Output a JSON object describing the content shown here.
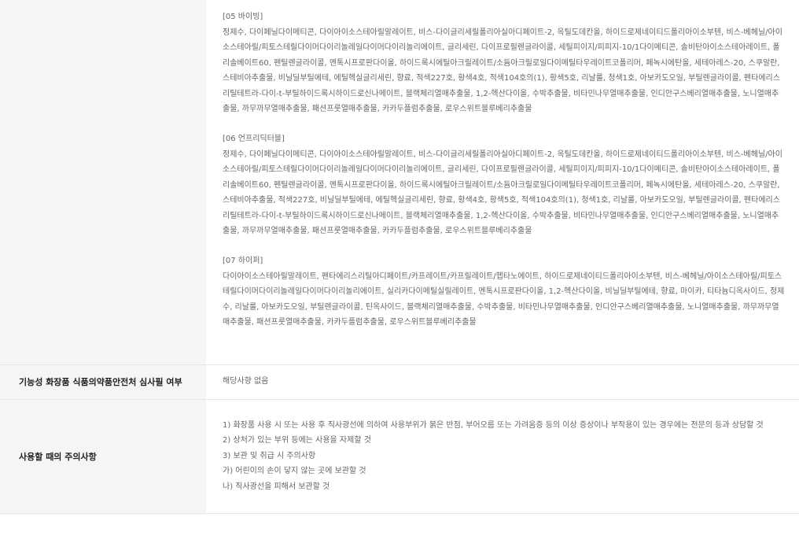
{
  "ingredients": {
    "blocks": [
      {
        "title": "[05 바이빙]",
        "text": "정제수, 다이페닐다이메티콘, 다이아이소스테아릴말레이트, 비스-다이글리세릴폴리아실아디페이트-2, 옥틸도데칸올, 하이드로제네이티드폴리아이소부텐, 비스-베헤닐/아이소스테아릴/피토스테릴다이머다이리놀레일다이머다이리놀리에이트, 글리세린, 다이프로필렌글라이콜, 세틸피이지/피피지-10/1다이메티콘, 솔비탄아이소스테아레이트, 폴리솔베이트60, 펜틸렌글라이콜, 멘톡시프로판다이올, 하이드록시에틸아크릴레이트/소듐아크릴로일다이메틸타우레이트코폴리머, 페녹시에탄올, 세테아레스-20, 스쿠알란, 스테비아추출물, 비닐딜부틸에테, 에틸헥실글리세린, 향료, 적색227호, 황색4호, 적색104호의(1), 황색5호, 리날룰, 청색1호, 아보카도오일, 부틸렌글라이콜, 펜타에리스리틸테트라-다이-t-부틸하이드록시하이드로신나메이트, 블랙체리열매추출물, 1,2-헥산다이올, 수박추출물, 비타민나무열매추출물, 인디안구스베리열매추출물, 노니열매추출물, 까무까무열매추출물, 패션프룻열매추출물, 카카두플럼추출물, 로우스위트블루베리추출물"
      },
      {
        "title": "[06 언프리딕터블]",
        "text": "정제수, 다이페닐다이메티콘, 다이아이소스테아릴말레이트, 비스-다이글리세릴폴리아실아디페이트-2, 옥틸도데칸올, 하이드로제네이티드폴리아이소부텐, 비스-베헤닐/아이소스테아릴/피토스테릴다이머다이리놀레일다이머다이리놀리에이트, 글리세린, 다이프로필렌글라이콜, 세틸피이지/피피지-10/1다이메티콘, 솔비탄아이소스테아레이트, 폴리솔베이트60, 펜틸렌글라이콜, 멘톡시프로판다이올, 하이드록시에틸아크릴레이트/소듐아크릴로일다이메틸타우레이트코폴리머, 페녹시에탄올, 세테아레스-20, 스쿠알란, 스테비아추출물, 적색227호, 비닐딜부틸에테, 에틸헥실글리세린, 향료, 황색4호, 황색5호, 적색104호의(1), 청색1호, 리날룰, 아보카도오일, 부틸렌글라이콜, 펜타에리스리틸테트라-다이-t-부틸하이드록시하이드로신나메이트, 블랙체리열매추출물, 1,2-헥산다이올, 수박추출물, 비타민나무열매추출물, 인디안구스베리열매추출물, 노니열매추출물, 까무까무열매추출물, 패션프룻열매추출물, 카카두플럼추출물, 로우스위트블루베리추출물"
      },
      {
        "title": "[07 하이퍼]",
        "text": "다이아이소스테아릴말레이트, 펜타에리스리틸아디페이트/카프레이트/카프릴레이트/헵타노에이트, 하이드로제네이티드폴리아이소부텐, 비스-베헤닐/아이소스테아릴/피토스테릴다이머다이리놀레일다이머다이리놀리에이트, 실리카다이메틸실릴레이트, 멘톡시프로판다이올, 1,2-헥산다이올, 비닐딜부틸에테, 향료, 마이카, 티타늄디옥사이드, 정제수, 리날룰, 아보카도오일, 부틸렌글라이콜, 틴옥사이드, 블랙체리열매추출물, 수박추출물, 비타민나무열매추출물, 인디안구스베리열매추출물, 노니열매추출물, 까무까무열매추출물, 패션프룻열매추출물, 카카두플럼추출물, 로우스위트블루베리추출물"
      }
    ]
  },
  "review": {
    "label": "기능성 화장품 식품의약품안전처 심사필 여부",
    "value": "해당사항 없음"
  },
  "caution": {
    "label": "사용할 때의 주의사항",
    "lines": [
      "1) 화장품 사용 시 또는 사용 후 직사광선에 의하여 사용부위가 붉은 반점, 부어오름 또는 가려움증 등의 이상 증상이나 부작용이 있는 경우에는 전문의 등과 상담할 것",
      "2) 상처가 있는 부위 등에는 사용을 자제할 것",
      "3) 보관 및 취급 시 주의사항",
      "가) 어린이의 손이 닿지 않는 곳에 보관할 것",
      "나) 직사광선을 피해서 보관할 것"
    ]
  }
}
